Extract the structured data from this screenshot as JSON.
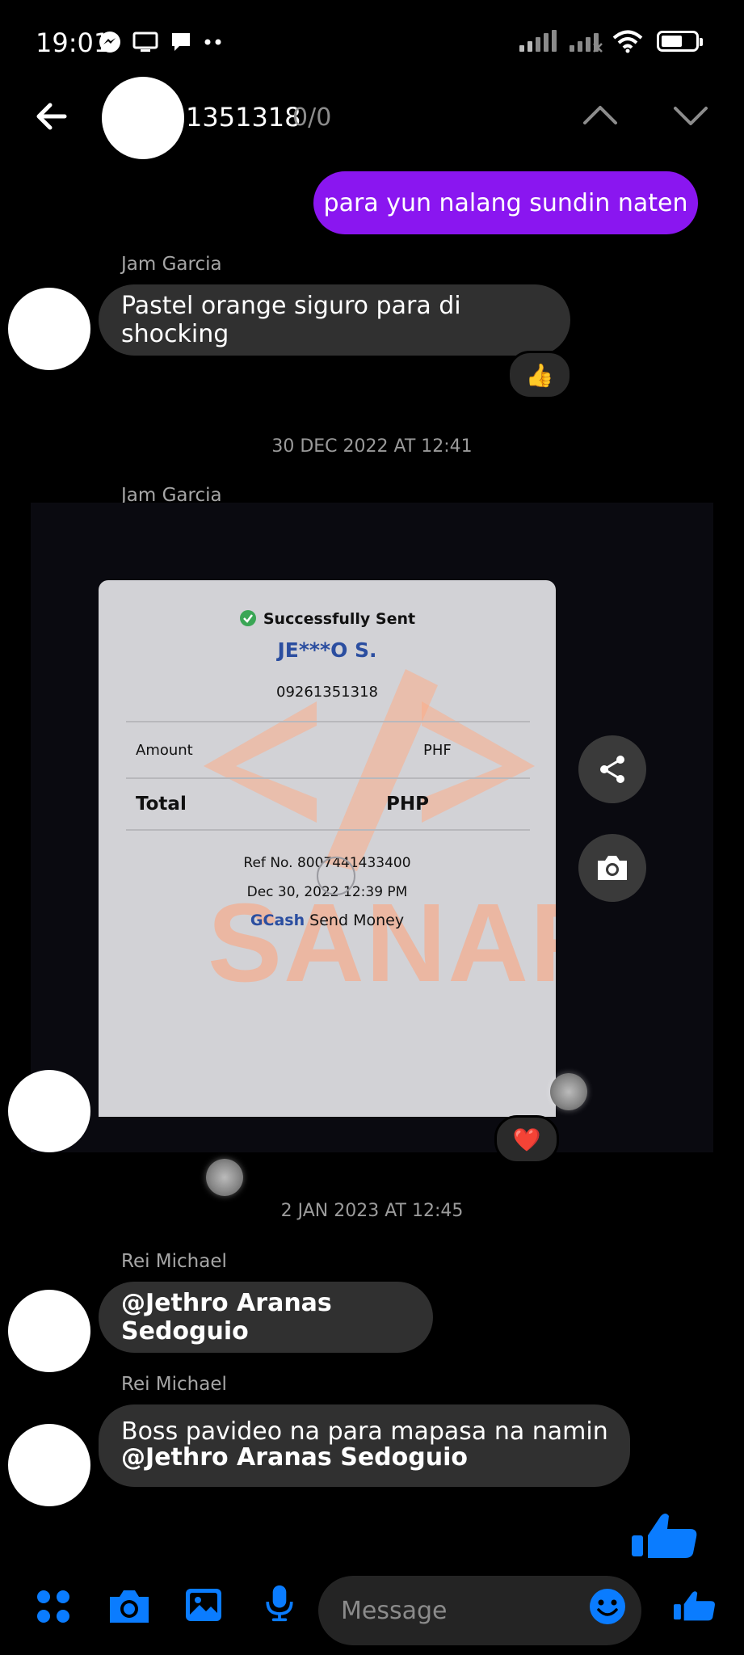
{
  "status_bar": {
    "time": "19:01",
    "left_icons": [
      "messenger-icon",
      "screen-cast-icon",
      "chat-bubble-icon",
      "more-dots-icon"
    ],
    "battery_level": "55%"
  },
  "header": {
    "title": "1351318",
    "match_count": "0/0"
  },
  "messages": {
    "outgoing_1": "para yun nalang sundin naten",
    "msg_1": {
      "sender": "Jam Garcia",
      "text": "Pastel orange siguro para di shocking",
      "reaction": "👍"
    },
    "date_1": "30 DEC 2022 AT 12:41",
    "msg_2": {
      "sender": "Jam Garcia",
      "reaction": "❤️"
    },
    "date_2": "2 JAN 2023 AT 12:45",
    "msg_3": {
      "sender": "Rei Michael",
      "text": "@Jethro Aranas Sedoguio"
    },
    "msg_4": {
      "sender": "Rei Michael",
      "line1": "Boss pavideo na para mapasa na namin",
      "line2": "@Jethro Aranas Sedoguio"
    }
  },
  "receipt": {
    "status": "Successfully Sent",
    "recipient": "JE***O S.",
    "number": "09261351318",
    "amount_label": "Amount",
    "amount_currency": "PHF",
    "total_label": "Total",
    "total_currency": "PHP",
    "ref": "Ref No. 8007441433400",
    "date": "Dec 30, 2022 12:39 PM",
    "brand": "GCash",
    "service": "Send Money",
    "watermark": "SANARA"
  },
  "composer": {
    "placeholder": "Message"
  },
  "colors": {
    "accent": "#0a7cff",
    "outgoing_bubble": "#8a16f0",
    "incoming_bubble": "#303030"
  }
}
